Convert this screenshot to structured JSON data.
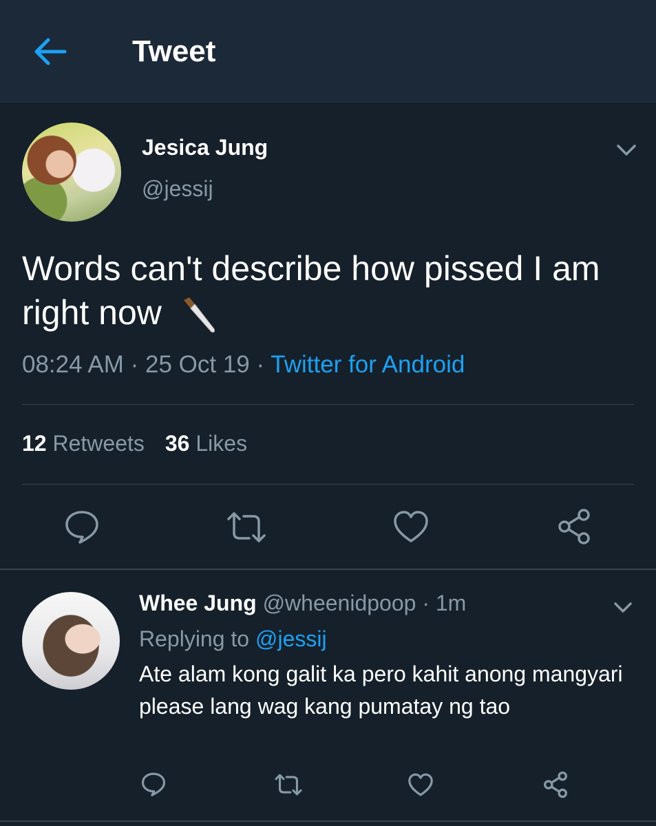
{
  "header": {
    "title": "Tweet",
    "back_icon": "arrow-left-icon"
  },
  "tweet": {
    "author_name": "Jesica Jung",
    "author_handle": "@jessij",
    "text": "Words can't describe how pissed I am right now",
    "emoji": "knife-icon",
    "time": "08:24 AM",
    "sep1": " · ",
    "date": "25 Oct 19",
    "sep2": " · ",
    "source": "Twitter for Android",
    "retweets_count": "12",
    "retweets_label": "Retweets",
    "likes_count": "36",
    "likes_label": "Likes"
  },
  "reply": {
    "author_name": "Whee Jung",
    "author_handle": "@wheenidpoop",
    "separator": " · ",
    "time": "1m",
    "replying_label": "Replying to",
    "replying_mention": "@jessij",
    "text": "Ate alam kong galit ka pero kahit anong mangyari please lang wag kang pumatay ng tao"
  },
  "colors": {
    "background": "#15202b",
    "header": "#1c2938",
    "accent": "#1da1f2",
    "muted": "#8899a6",
    "divider": "#38444d"
  }
}
